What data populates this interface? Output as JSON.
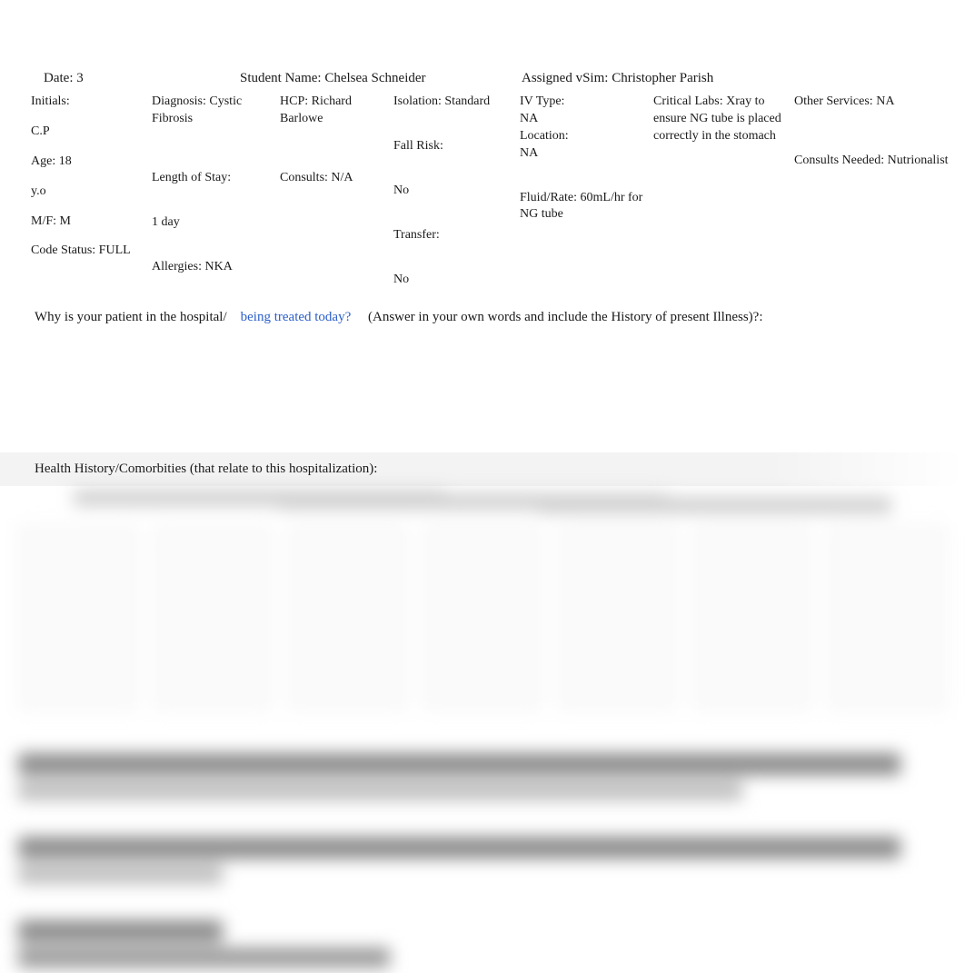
{
  "header": {
    "date_label": "Date: ",
    "date_value": "3",
    "student_label": "Student Name: ",
    "student_value": "Chelsea Schneider",
    "vsim_label": "Assigned vSim: ",
    "vsim_value": "Christopher Parish"
  },
  "col1": {
    "initials_label": "Initials:",
    "initials_value": "C.P",
    "age_label": "Age: ",
    "age_value": "18",
    "age_unit": "y.o",
    "mf_label": "M/F: ",
    "mf_value": "M",
    "code_label": "Code Status: ",
    "code_value": "FULL"
  },
  "col2": {
    "dx_label": "Diagnosis: ",
    "dx_value": "Cystic Fibrosis",
    "los_label": "Length of Stay:",
    "los_value": "1 day",
    "allergy_label": "Allergies: ",
    "allergy_value": "NKA"
  },
  "col3": {
    "hcp_label": "HCP: ",
    "hcp_value": "Richard Barlowe",
    "consults_label": "Consults: ",
    "consults_value": "N/A"
  },
  "col4": {
    "iso_label": "Isolation: ",
    "iso_value": "Standard",
    "fall_label": "Fall Risk:",
    "fall_value": "No",
    "transfer_label": "Transfer:",
    "transfer_value": "No"
  },
  "col5": {
    "iv_label": "IV Type:",
    "iv_value": "NA",
    "loc_label": "Location:",
    "loc_value": "NA",
    "fluid_label": "Fluid/Rate: ",
    "fluid_value": "60mL/hr for NG tube"
  },
  "col6": {
    "crit_label": "Critical Labs: ",
    "crit_value": "Xray to ensure NG tube is placed correctly in the stomach"
  },
  "col7": {
    "other_label": "Other Services: ",
    "other_value": "NA",
    "cn_label": "Consults Needed: ",
    "cn_value": "Nutrionalist"
  },
  "q1": {
    "pre": "Why is your patient in the hospital/",
    "blue": "being treated today?",
    "post": "(Answer in your own words and include the History of present Illness)?:"
  },
  "hh": {
    "header": "Health History/Comorbities (that relate to this hospitalization):"
  }
}
